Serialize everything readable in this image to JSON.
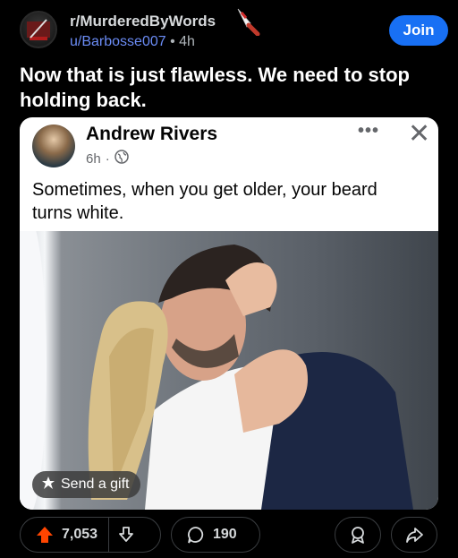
{
  "post": {
    "subreddit": "r/MurderedByWords",
    "author": "u/Barbosse007",
    "separator": "•",
    "age": "4h",
    "join_label": "Join",
    "title": "Now that is just flawless. We need to stop holding back."
  },
  "embedded": {
    "name": "Andrew Rivers",
    "time": "6h",
    "separator": "·",
    "text": "Sometimes, when you get older, your beard turns white.",
    "more_icon": "more-dots-icon",
    "close_icon": "close-icon",
    "gift_label": "Send a gift"
  },
  "actions": {
    "upvotes": "7,053",
    "comments": "190"
  },
  "colors": {
    "join": "#1870f4",
    "upvote": "#ff4500",
    "author_link": "#6b8cf5"
  }
}
